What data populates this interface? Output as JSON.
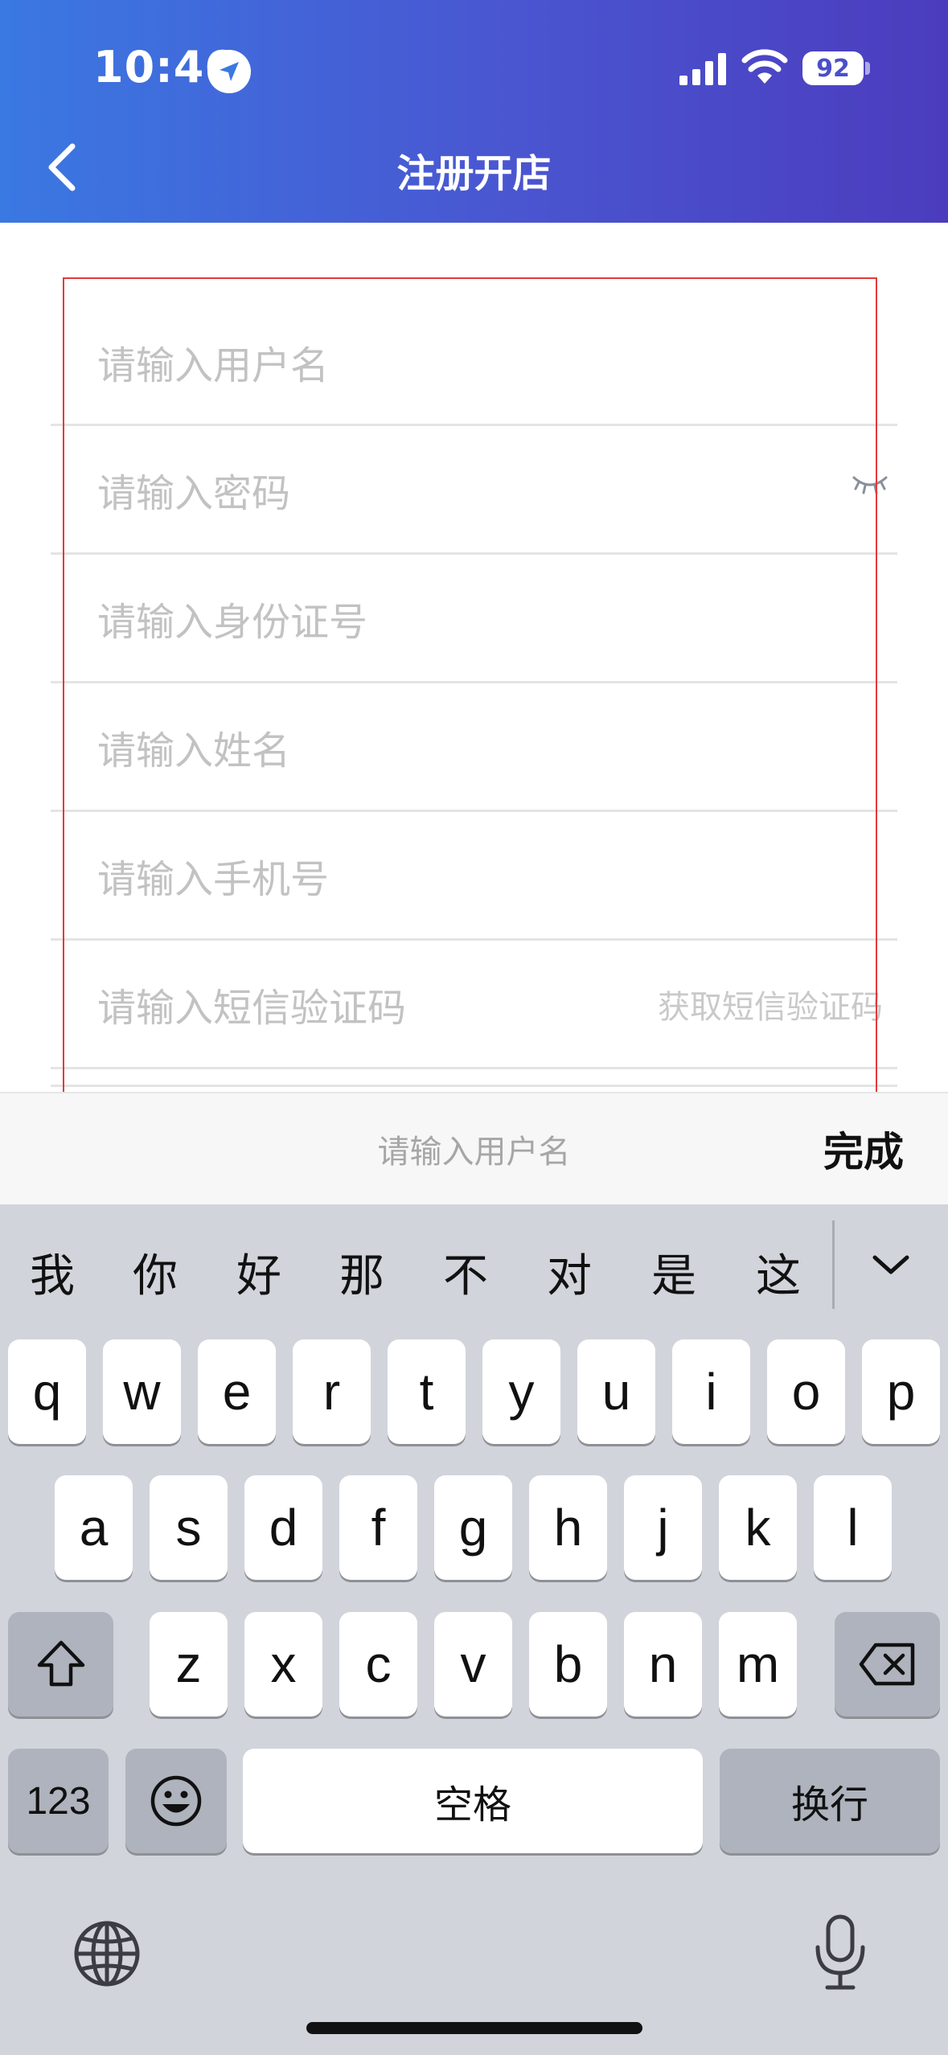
{
  "status_bar": {
    "time": "10:46",
    "battery": "92"
  },
  "nav": {
    "title": "注册开店"
  },
  "form": {
    "username_placeholder": "请输入用户名",
    "password_placeholder": "请输入密码",
    "id_number_placeholder": "请输入身份证号",
    "name_placeholder": "请输入姓名",
    "phone_placeholder": "请输入手机号",
    "sms_code_placeholder": "请输入短信验证码",
    "get_sms_code_label": "获取短信验证码"
  },
  "accessory_bar": {
    "field_preview": "请输入用户名",
    "done_label": "完成"
  },
  "keyboard": {
    "candidates": [
      "我",
      "你",
      "好",
      "那",
      "不",
      "对",
      "是",
      "这"
    ],
    "row1": [
      "q",
      "w",
      "e",
      "r",
      "t",
      "y",
      "u",
      "i",
      "o",
      "p"
    ],
    "row2": [
      "a",
      "s",
      "d",
      "f",
      "g",
      "h",
      "j",
      "k",
      "l"
    ],
    "row3": [
      "z",
      "x",
      "c",
      "v",
      "b",
      "n",
      "m"
    ],
    "numbers_label": "123",
    "space_label": "空格",
    "return_label": "换行"
  },
  "colors": {
    "header_start": "#3a78e2",
    "header_end": "#4b3cbe",
    "highlight_box": "#e23a3a"
  }
}
